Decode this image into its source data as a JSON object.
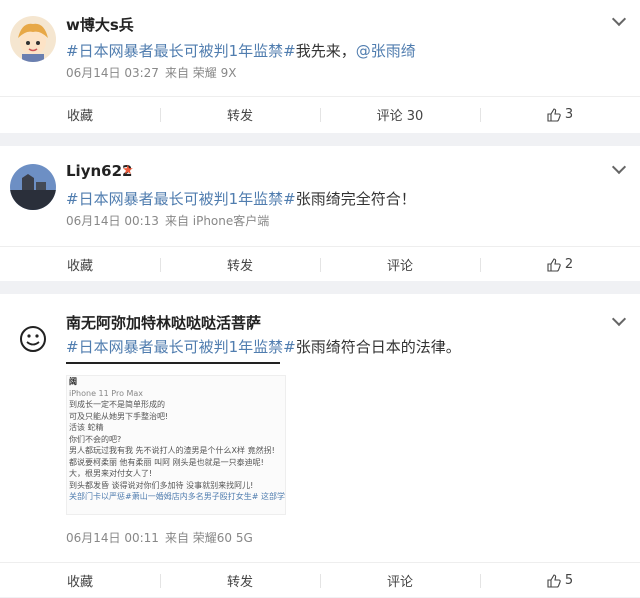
{
  "colors": {
    "link": "#507daf",
    "background": "#f0f1f4",
    "badge": "#ef5a3a"
  },
  "posts": [
    {
      "author": "w博大s兵",
      "tag": "#日本网暴者最长可被判1年监禁#",
      "text": "我先来，",
      "mention": "@张雨绮",
      "date": "06月14日 03:27",
      "source": "来自 荣耀 9X",
      "favorite": "收藏",
      "repost": "转发",
      "comment": "评论 30",
      "like": "3"
    },
    {
      "author": "Liyn622",
      "tag": "#日本网暴者最长可被判1年监禁#",
      "text": "张雨绮完全符合！",
      "date": "06月14日 00:13",
      "source": "来自 iPhone客户端",
      "favorite": "收藏",
      "repost": "转发",
      "comment": "评论",
      "like": "2"
    },
    {
      "author": "南无阿弥加特林哒哒哒活菩萨",
      "tag": "#日本网暴者最长可被判1年监禁#",
      "text": "张雨绮符合日本的法律。",
      "date": "06月14日 00:11",
      "source": "来自 荣耀60 5G",
      "favorite": "收藏",
      "repost": "转发",
      "comment": "评论",
      "like": "5",
      "image_lines": [
        "阔",
        "iPhone 11 Pro Max",
        "到成长一定不是简单形成的",
        "可及只能从她男下手整治吧!",
        "活该 蛇精",
        "你们不会的吧?",
        "男人都玩过我有我 先不说打人的渣男是个什么X样 竟然拐!",
        "都说要柯柔丽 他有柔丽 叫阿 刚头是也就是一只泰迪呢!",
        "大，根男来对付女人了!",
        "到头都发昏 谈得说对你们多加待 没事就别来找阿儿!",
        "关部门卡以严惩#萧山一婚姆店内多名男子殴打女生# 这部学习"
      ]
    }
  ]
}
